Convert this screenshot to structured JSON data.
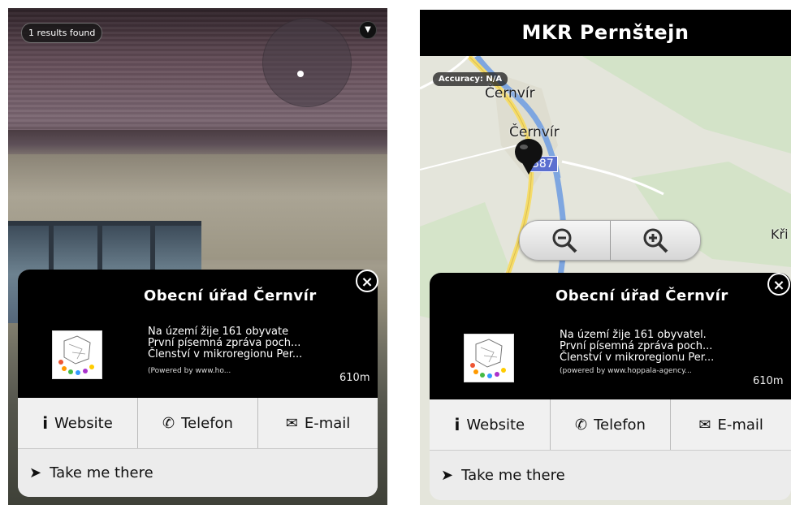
{
  "left_screen": {
    "results_text": "1 results found",
    "menu_icon": "chevron-down-icon",
    "popup": {
      "title": "Obecní úřad Černvír",
      "desc_line1": "Na území žije 161 obyvate",
      "desc_line2": "První písemná zpráva poch...",
      "desc_line3": "Členství v mikroregionu Per...",
      "powered": "(Powered by www.ho...",
      "distance": "610m",
      "website_label": "Website",
      "telefon_label": "Telefon",
      "email_label": "E-mail",
      "take_me_there_label": "Take me there"
    }
  },
  "right_screen": {
    "title": "MKR Pernštejn",
    "accuracy_text": "Accuracy: N/A",
    "map_labels": {
      "place1": "Černvír",
      "place2": "Černvír",
      "road_number": "387",
      "edge_label": "Kři"
    },
    "zoom_out_icon": "zoom-out-icon",
    "zoom_in_icon": "zoom-in-icon",
    "popup": {
      "title": "Obecní úřad Černvír",
      "desc_line1": "Na území žije 161 obyvatel.",
      "desc_line2": "První písemná zpráva poch...",
      "desc_line3": "Členství v mikroregionu Per...",
      "powered": "(powered by www.hoppala-agency...",
      "distance": "610m",
      "website_label": "Website",
      "telefon_label": "Telefon",
      "email_label": "E-mail",
      "take_me_there_label": "Take me there"
    }
  },
  "colors": {
    "popup_header": "#000000",
    "button_bg": "#f0f0f0",
    "road_badge": "#5b6fd0",
    "river": "#7ea6e0",
    "road": "#f5dc6a"
  }
}
